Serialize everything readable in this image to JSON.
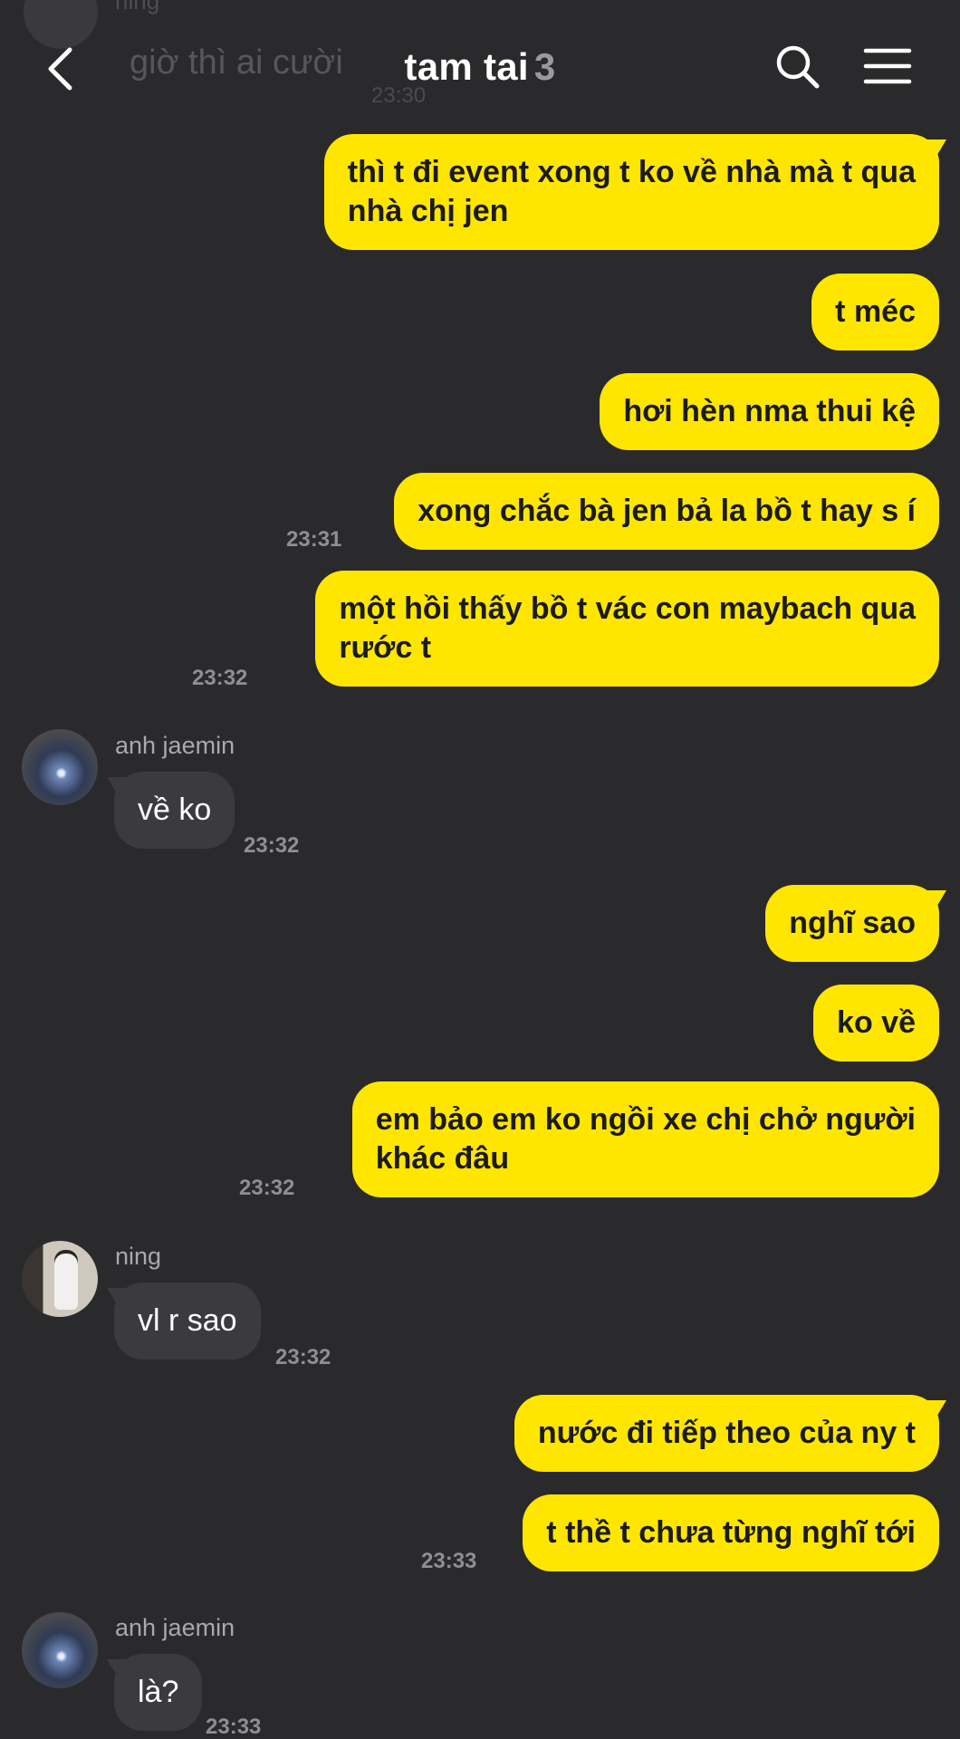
{
  "colors": {
    "background": "#2a2a2d",
    "my_bubble": "#ffe600",
    "their_bubble": "#3b3b3f",
    "timestamp": "#8e8e93"
  },
  "header": {
    "title": "tam tai",
    "member_count": "3",
    "back_icon": "chevron-left-icon",
    "search_icon": "search-icon",
    "menu_icon": "hamburger-menu-icon"
  },
  "ghost_preview": {
    "sender": "ning",
    "text": "giờ thì ai cười",
    "time": "23:30"
  },
  "messages": [
    {
      "from": "me",
      "lines": [
        "thì t đi event xong t ko về nhà mà t qua",
        "nhà chị jen"
      ]
    },
    {
      "from": "me",
      "lines": [
        "t méc"
      ]
    },
    {
      "from": "me",
      "lines": [
        "hơi hèn nma thui kệ"
      ]
    },
    {
      "from": "me",
      "lines": [
        "xong chắc bà jen bả la bồ t hay s í"
      ],
      "time": "23:31"
    },
    {
      "from": "me",
      "lines": [
        "một hồi thấy bồ t vác con maybach qua",
        "rước t"
      ],
      "time": "23:32"
    },
    {
      "from": "them",
      "sender": "anh jaemin",
      "lines": [
        "về ko"
      ],
      "time": "23:32"
    },
    {
      "from": "me",
      "lines": [
        "nghĩ sao"
      ]
    },
    {
      "from": "me",
      "lines": [
        "ko về"
      ]
    },
    {
      "from": "me",
      "lines": [
        "em bảo em ko ngồi xe chị chở người",
        "khác đâu"
      ],
      "time": "23:32"
    },
    {
      "from": "them",
      "sender": "ning",
      "lines": [
        "vl r sao"
      ],
      "time": "23:32"
    },
    {
      "from": "me",
      "lines": [
        "nước đi tiếp theo của ny t"
      ]
    },
    {
      "from": "me",
      "lines": [
        "t thề t chưa từng nghĩ tới"
      ],
      "time": "23:33"
    },
    {
      "from": "them",
      "sender": "anh jaemin",
      "lines": [
        "là?"
      ],
      "time": "23:33"
    }
  ]
}
